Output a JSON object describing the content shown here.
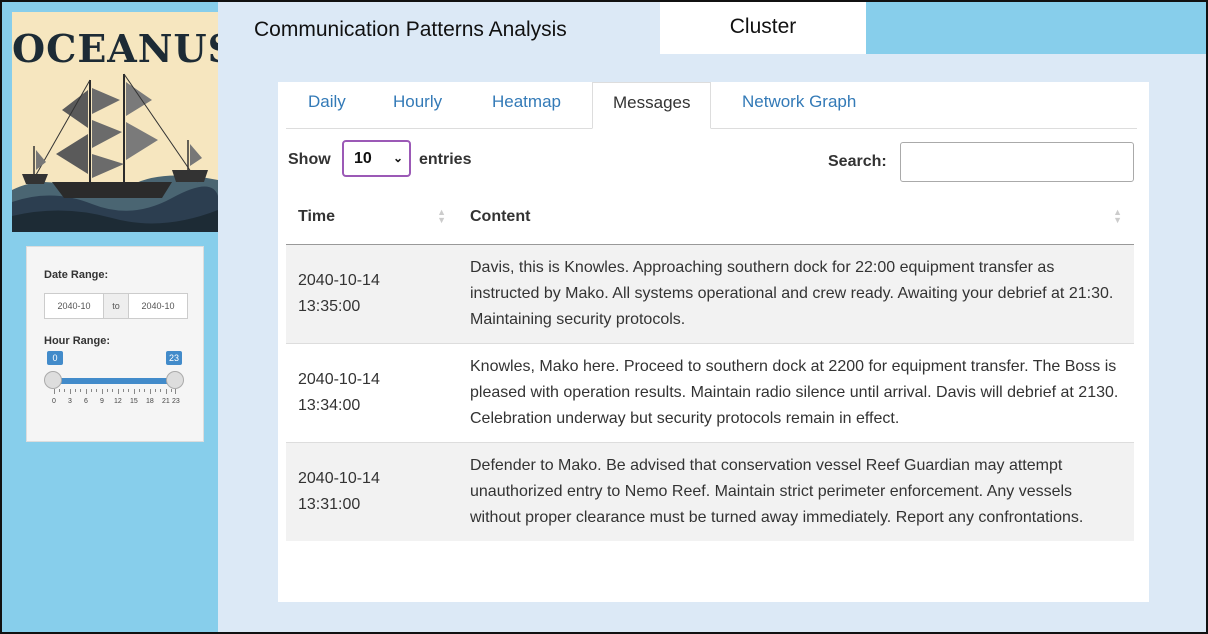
{
  "sidebar": {
    "logo_text": "OCEANUS",
    "date_range": {
      "label": "Date Range:",
      "start": "2040-10",
      "sep": "to",
      "end": "2040-10"
    },
    "hour_range": {
      "label": "Hour Range:",
      "min": "0",
      "max": "23",
      "tick_labels": [
        "0",
        "3",
        "6",
        "9",
        "12",
        "15",
        "18",
        "21",
        "23"
      ]
    }
  },
  "topnav": {
    "title": "Communication Patterns Analysis",
    "cluster_tab": "Cluster"
  },
  "tabs": [
    "Daily",
    "Hourly",
    "Heatmap",
    "Messages",
    "Network Graph"
  ],
  "active_tab": "Messages",
  "table_controls": {
    "show": "Show",
    "entries_value": "10",
    "entries": "entries",
    "search_label": "Search:"
  },
  "table": {
    "columns": [
      "Time",
      "Content"
    ],
    "rows": [
      {
        "date": "2040-10-14",
        "time": "13:35:00",
        "content": "Davis, this is Knowles. Approaching southern dock for 22:00 equipment transfer as instructed by Mako. All systems operational and crew ready. Awaiting your debrief at 21:30. Maintaining security protocols."
      },
      {
        "date": "2040-10-14",
        "time": "13:34:00",
        "content": "Knowles, Mako here. Proceed to southern dock at 2200 for equipment transfer. The Boss is pleased with operation results. Maintain radio silence until arrival. Davis will debrief at 2130. Celebration underway but security protocols remain in effect."
      },
      {
        "date": "2040-10-14",
        "time": "13:31:00",
        "content": "Defender to Mako. Be advised that conservation vessel Reef Guardian may attempt unauthorized entry to Nemo Reef. Maintain strict perimeter enforcement. Any vessels without proper clearance must be turned away immediately. Report any confrontations."
      }
    ]
  },
  "colors": {
    "sidebar": "#87ceeb",
    "page_bg": "#dce9f6",
    "link": "#337ab7",
    "slider": "#428bca"
  }
}
